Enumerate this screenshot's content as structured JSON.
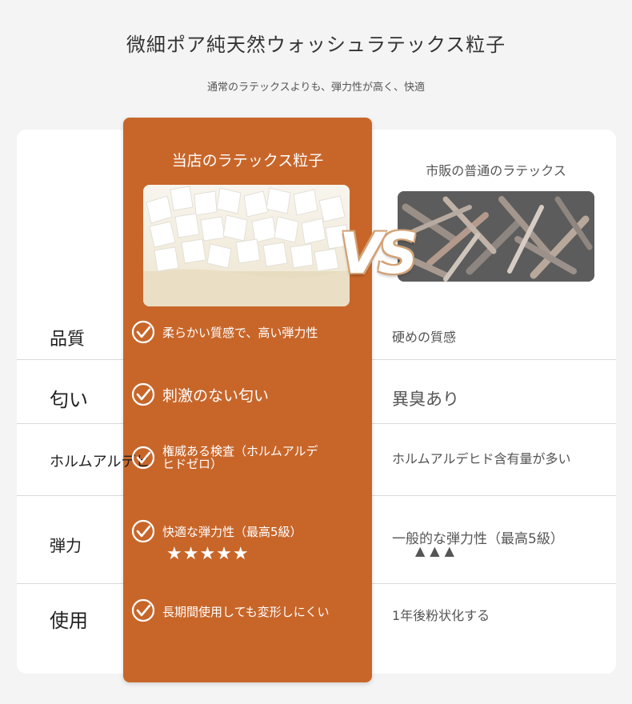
{
  "header": {
    "title": "微細ポア純天然ウォッシュラテックス粒子",
    "subtitle": "通常のラテックスよりも、弾力性が高く、快適"
  },
  "comparison": {
    "ours_heading": "当店のラテックス粒子",
    "theirs_heading": "市販の普通のラテックス",
    "vs_label": "VS",
    "rows": [
      {
        "label": "品質",
        "ours": "柔らかい質感で、高い弾力性",
        "theirs": "硬めの質感"
      },
      {
        "label": "匂い",
        "ours": "刺激のない匂い",
        "theirs": "異臭あり"
      },
      {
        "label": "ホルムアルデヒ",
        "ours_line1": "権威ある検査（ホルムアルデ",
        "ours_line2": "ヒドゼロ）",
        "theirs": "ホルムアルデヒド含有量が多い"
      },
      {
        "label": "弾力",
        "ours": "快適な弾力性（最高5級）",
        "ours_stars": "★★★★★",
        "theirs": "一般的な弾力性（最高5級）",
        "theirs_stars": "▲▲▲"
      },
      {
        "label": "使用",
        "ours": "長期間使用しても変形しにくい",
        "theirs": "1年後粉状化する"
      }
    ]
  },
  "icons": {
    "check": "check-circle-icon",
    "star": "star-icon"
  },
  "colors": {
    "accent": "#c8662a",
    "background": "#f4f4f4",
    "card": "#ffffff"
  }
}
